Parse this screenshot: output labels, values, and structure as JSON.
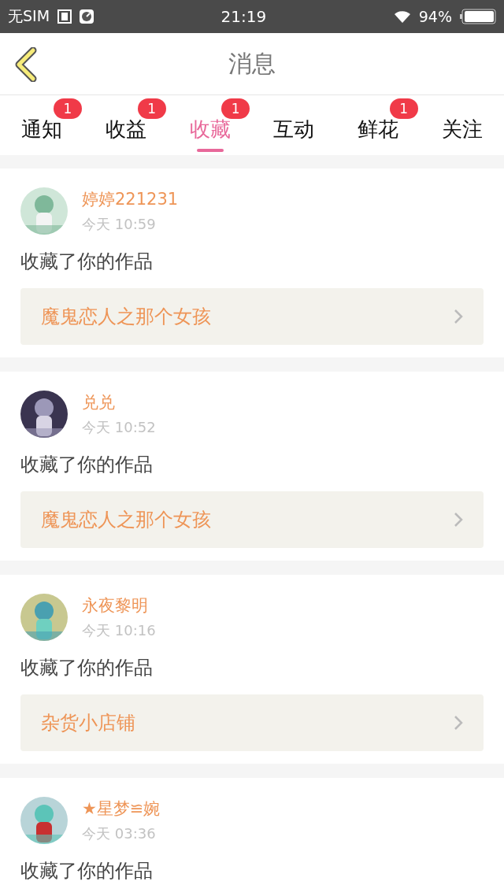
{
  "status_bar": {
    "carrier": "无SIM",
    "time": "21:19",
    "battery": "94%"
  },
  "header": {
    "title": "消息"
  },
  "tabs": [
    {
      "label": "通知",
      "badge": "1",
      "selected": false
    },
    {
      "label": "收益",
      "badge": "1",
      "selected": false
    },
    {
      "label": "收藏",
      "badge": "1",
      "selected": true
    },
    {
      "label": "互动",
      "selected": false
    },
    {
      "label": "鲜花",
      "badge": "1",
      "selected": false
    },
    {
      "label": "关注",
      "selected": false
    }
  ],
  "messages": [
    {
      "user": "婷婷221231",
      "time": "今天 10:59",
      "action": "收藏了你的作品",
      "work": "魔鬼恋人之那个女孩"
    },
    {
      "user": "兑兑",
      "time": "今天 10:52",
      "action": "收藏了你的作品",
      "work": "魔鬼恋人之那个女孩"
    },
    {
      "user": "永夜黎明",
      "time": "今天 10:16",
      "action": "收藏了你的作品",
      "work": "杂货小店铺"
    },
    {
      "user": "★星梦≌婉",
      "time": "今天 03:36",
      "action": "收藏了你的作品"
    }
  ]
}
